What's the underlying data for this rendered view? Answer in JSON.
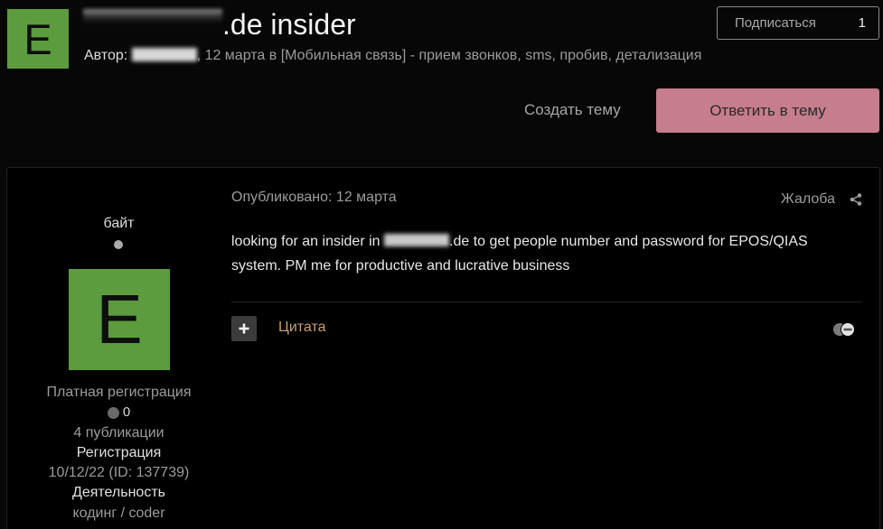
{
  "topic": {
    "avatar_letter": "E",
    "title": ".de insider",
    "author_label": "Автор:",
    "meta_date": ", 12 марта в",
    "forum_link": "[Мобильная связь] - прием звонков, sms, пробив, детализация",
    "follow": {
      "label": "Подписаться",
      "count": "1"
    },
    "create_topic_label": "Создать тему",
    "reply_label": "Ответить в тему"
  },
  "post": {
    "author": {
      "name": "байт",
      "avatar_letter": "E",
      "group": "Платная регистрация",
      "reputation": "0",
      "posts": "4 публикации",
      "joined_label": "Регистрация",
      "joined_value": "10/12/22 (ID: 137739)",
      "activity_label": "Деятельность",
      "activity_value": "кодинг / coder"
    },
    "published": "Опубликовано: 12 марта",
    "report_label": "Жалоба",
    "body_before": "looking for an insider in",
    "body_after": ".de to get people number and password for EPOS/QIAS system. PM me for productive and lucrative business",
    "quote_label": "Цитата"
  },
  "colors": {
    "accent": "#c67d8d",
    "avatar_bg": "#5c9b3e",
    "quote_link": "#c9a06b"
  },
  "icons": {
    "status": "offline-status-icon",
    "reputation": "reputation-icon",
    "share": "share-icon",
    "multiquote": "plus-icon",
    "reaction": "reaction-icon"
  }
}
